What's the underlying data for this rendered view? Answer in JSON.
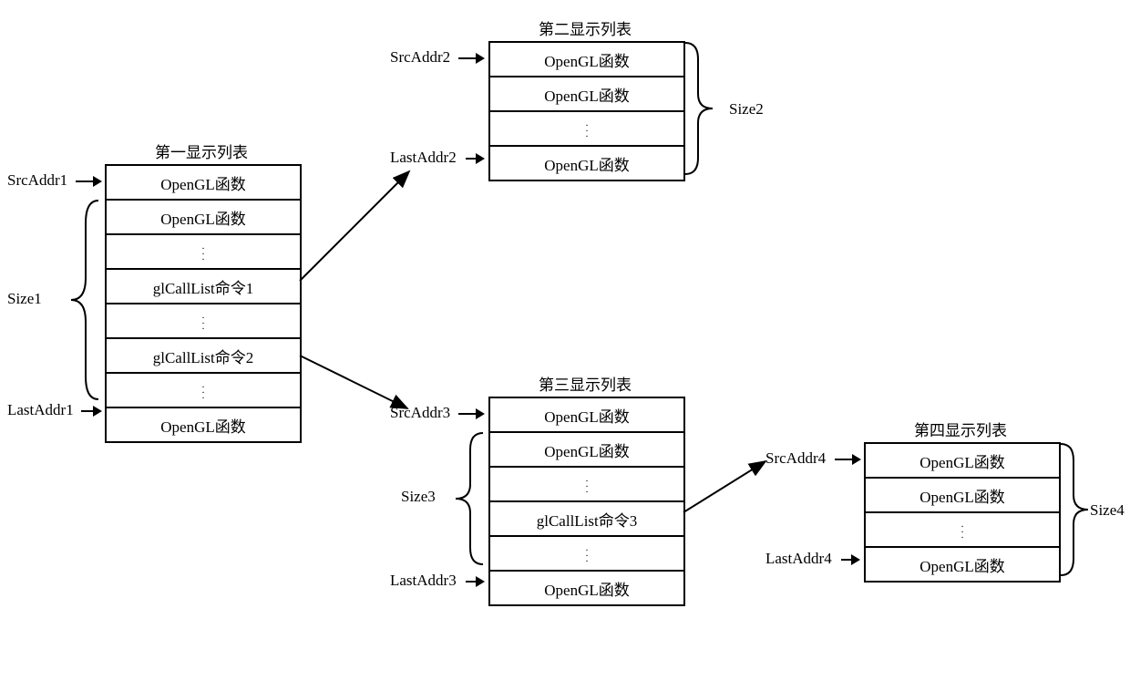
{
  "list1": {
    "title": "第一显示列表",
    "srcLabel": "SrcAddr1",
    "lastLabel": "LastAddr1",
    "sizeLabel": "Size1",
    "rows": [
      "OpenGL函数",
      "OpenGL函数",
      ".",
      ".",
      ".",
      "glCallList命令1",
      ".",
      ".",
      ".",
      "glCallList命令2",
      ".",
      ".",
      ".",
      "OpenGL函数"
    ]
  },
  "list2": {
    "title": "第二显示列表",
    "srcLabel": "SrcAddr2",
    "lastLabel": "LastAddr2",
    "sizeLabel": "Size2",
    "rows": [
      "OpenGL函数",
      "OpenGL函数",
      ".",
      ".",
      ".",
      "OpenGL函数"
    ]
  },
  "list3": {
    "title": "第三显示列表",
    "srcLabel": "SrcAddr3",
    "lastLabel": "LastAddr3",
    "sizeLabel": "Size3",
    "rows": [
      "OpenGL函数",
      "OpenGL函数",
      ".",
      ".",
      ".",
      "glCallList命令3",
      ".",
      ".",
      ".",
      "OpenGL函数"
    ]
  },
  "list4": {
    "title": "第四显示列表",
    "srcLabel": "SrcAddr4",
    "lastLabel": "LastAddr4",
    "sizeLabel": "Size4",
    "rows": [
      "OpenGL函数",
      "OpenGL函数",
      ".",
      ".",
      ".",
      "OpenGL函数"
    ]
  }
}
